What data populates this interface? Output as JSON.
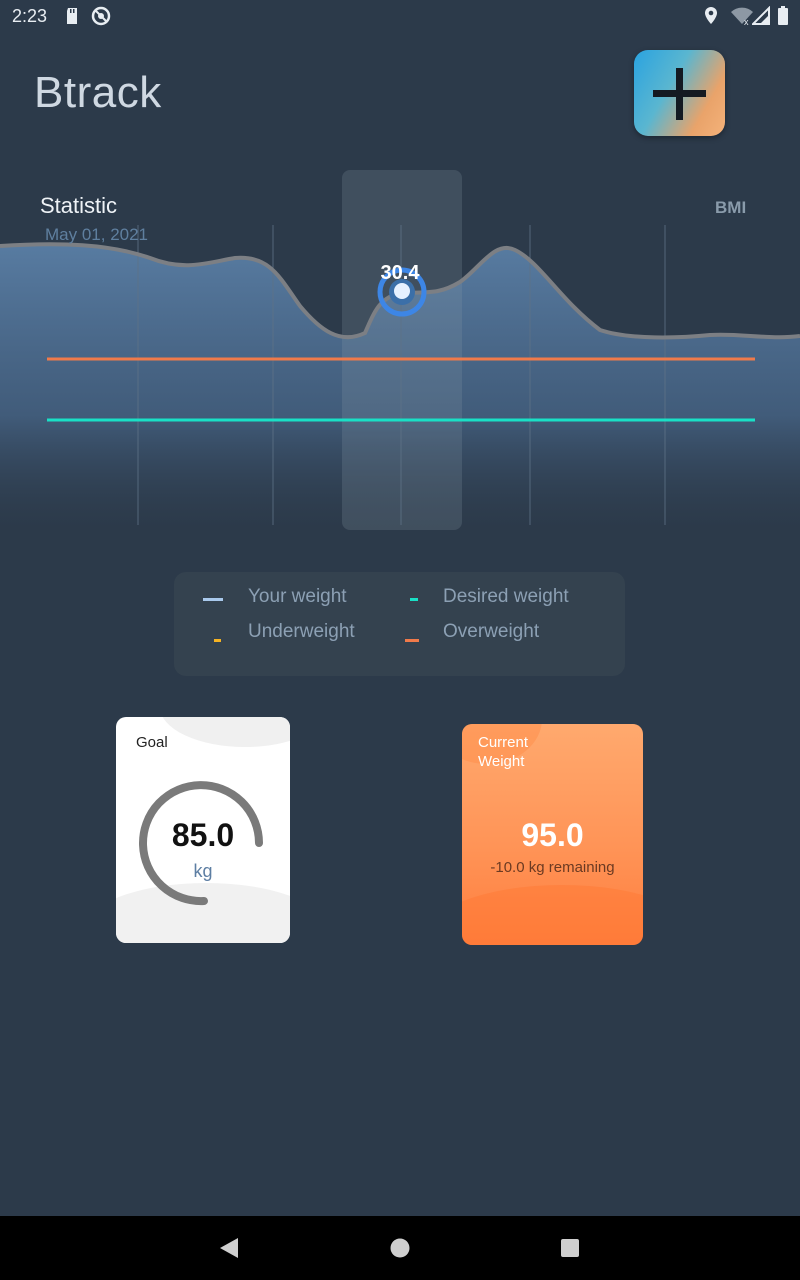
{
  "status_bar": {
    "time": "2:23",
    "icons": [
      "sd-card-icon",
      "do-not-disturb-icon",
      "location-icon",
      "wifi-icon",
      "signal-icon",
      "battery-icon"
    ]
  },
  "header": {
    "title": "Btrack",
    "add_button_icon": "plus-icon"
  },
  "chart": {
    "title": "Statistic",
    "date": "May 01, 2021",
    "metric": "BMI",
    "selected_value": "30.4"
  },
  "chart_data": {
    "type": "area",
    "title": "Statistic",
    "subtitle": "May 01, 2021",
    "ylabel": "BMI",
    "series": [
      {
        "name": "Your weight",
        "color": "#7e93a8"
      },
      {
        "name": "Overweight",
        "color": "#f07a4a"
      },
      {
        "name": "Desired weight",
        "color": "#19e0c6"
      }
    ],
    "highlighted_point": 30.4,
    "grid": true
  },
  "legend": {
    "items": [
      {
        "label": "Your weight",
        "color": "#a9c9ec"
      },
      {
        "label": "Desired weight",
        "color": "#19e0c6"
      },
      {
        "label": "Underweight",
        "color": "#f5b323"
      },
      {
        "label": "Overweight",
        "color": "#f07a4a"
      }
    ]
  },
  "goal_card": {
    "label": "Goal",
    "value": "85.0",
    "unit": "kg"
  },
  "current_weight_card": {
    "label": "Current Weight",
    "value": "95.0",
    "remaining": "-10.0 kg remaining"
  },
  "colors": {
    "background": "#2c3a4a",
    "accent_orange": "#ff9457",
    "desired_line": "#19e0c6",
    "overweight_line": "#f07a4a"
  },
  "nav_bar": {
    "buttons": [
      "back-icon",
      "home-icon",
      "recents-icon"
    ]
  }
}
